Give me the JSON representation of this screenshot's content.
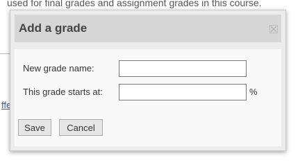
{
  "background": {
    "top_text": "used for final grades and assignment grades in this course.",
    "left_link": "ffe"
  },
  "dialog": {
    "title": "Add a grade",
    "close_icon": "close-icon",
    "fields": {
      "name": {
        "label": "New grade name:",
        "value": "",
        "placeholder": ""
      },
      "start": {
        "label": "This grade starts at:",
        "value": "",
        "placeholder": "",
        "suffix": "%"
      }
    },
    "buttons": {
      "save": "Save",
      "cancel": "Cancel"
    }
  },
  "colors": {
    "titlebar": "#d6d6d6",
    "dialog_bg": "#ececec",
    "body_bg": "#f9f9f9",
    "link": "#3a5bb5"
  }
}
